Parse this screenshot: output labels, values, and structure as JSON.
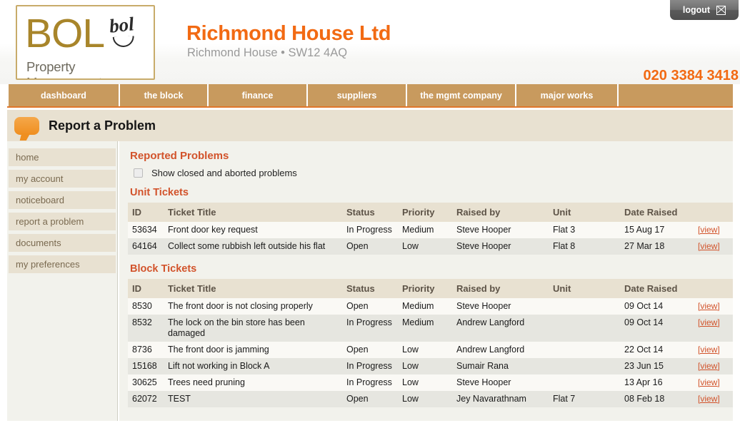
{
  "header": {
    "logo": {
      "main_text": "BOL",
      "script_text": "bol",
      "tagline": "Property Management"
    },
    "company_name": "Richmond House Ltd",
    "company_address": "Richmond House • SW12 4AQ",
    "phone": "020 3384 3418",
    "logout_label": "logout",
    "logout_icon": "close-box-icon"
  },
  "nav": {
    "items": [
      {
        "label": "dashboard"
      },
      {
        "label": "the block"
      },
      {
        "label": "finance"
      },
      {
        "label": "suppliers"
      },
      {
        "label": "the mgmt company"
      },
      {
        "label": "major works"
      },
      {
        "label": ""
      }
    ]
  },
  "page": {
    "icon": "speech-bubble-icon",
    "title": "Report a Problem"
  },
  "sidebar": {
    "items": [
      {
        "label": "home"
      },
      {
        "label": "my account"
      },
      {
        "label": "noticeboard"
      },
      {
        "label": "report a problem"
      },
      {
        "label": "documents"
      },
      {
        "label": "my preferences"
      }
    ]
  },
  "main": {
    "heading": "Reported Problems",
    "show_closed": {
      "label": "Show closed and aborted problems",
      "checked": false
    },
    "unit_tickets": {
      "heading": "Unit Tickets",
      "columns": [
        "ID",
        "Ticket Title",
        "Status",
        "Priority",
        "Raised by",
        "Unit",
        "Date Raised",
        ""
      ],
      "view_label": "[view]",
      "rows": [
        {
          "id": "53634",
          "title": "Front door key request",
          "status": "In Progress",
          "priority": "Medium",
          "raised_by": "Steve Hooper",
          "unit": "Flat 3",
          "date_raised": "15 Aug 17",
          "action": "[view]"
        },
        {
          "id": "64164",
          "title": "Collect some rubbish left outside his flat",
          "status": "Open",
          "priority": "Low",
          "raised_by": "Steve Hooper",
          "unit": "Flat 8",
          "date_raised": "27 Mar 18",
          "action": "[view]"
        }
      ]
    },
    "block_tickets": {
      "heading": "Block Tickets",
      "columns": [
        "ID",
        "Ticket Title",
        "Status",
        "Priority",
        "Raised by",
        "Unit",
        "Date Raised",
        ""
      ],
      "view_label": "[view]",
      "rows": [
        {
          "id": "8530",
          "title": "The front door is not closing properly",
          "status": "Open",
          "priority": "Medium",
          "raised_by": "Steve Hooper",
          "unit": "",
          "date_raised": "09 Oct 14",
          "action": "[view]"
        },
        {
          "id": "8532",
          "title": "The lock on the bin store has been damaged",
          "status": "In Progress",
          "priority": "Medium",
          "raised_by": "Andrew Langford",
          "unit": "",
          "date_raised": "09 Oct 14",
          "action": "[view]"
        },
        {
          "id": "8736",
          "title": "The front door is jamming",
          "status": "Open",
          "priority": "Low",
          "raised_by": "Andrew Langford",
          "unit": "",
          "date_raised": "22 Oct 14",
          "action": "[view]"
        },
        {
          "id": "15168",
          "title": "Lift not working in Block A",
          "status": "In Progress",
          "priority": "Low",
          "raised_by": "Sumair Rana",
          "unit": "",
          "date_raised": "23 Jun 15",
          "action": "[view]"
        },
        {
          "id": "30625",
          "title": "Trees need pruning",
          "status": "In Progress",
          "priority": "Low",
          "raised_by": "Steve Hooper",
          "unit": "",
          "date_raised": "13 Apr 16",
          "action": "[view]"
        },
        {
          "id": "62072",
          "title": "TEST",
          "status": "Open",
          "priority": "Low",
          "raised_by": "Jey Navarathnam",
          "unit": "Flat 7",
          "date_raised": "08 Feb 18",
          "action": "[view]"
        }
      ]
    }
  },
  "colors": {
    "accent_orange": "#f26a13",
    "heading_orange": "#d2532b",
    "nav_tan": "#c89a5e",
    "panel_beige": "#e8e1d1",
    "logo_gold": "#a8852a"
  }
}
